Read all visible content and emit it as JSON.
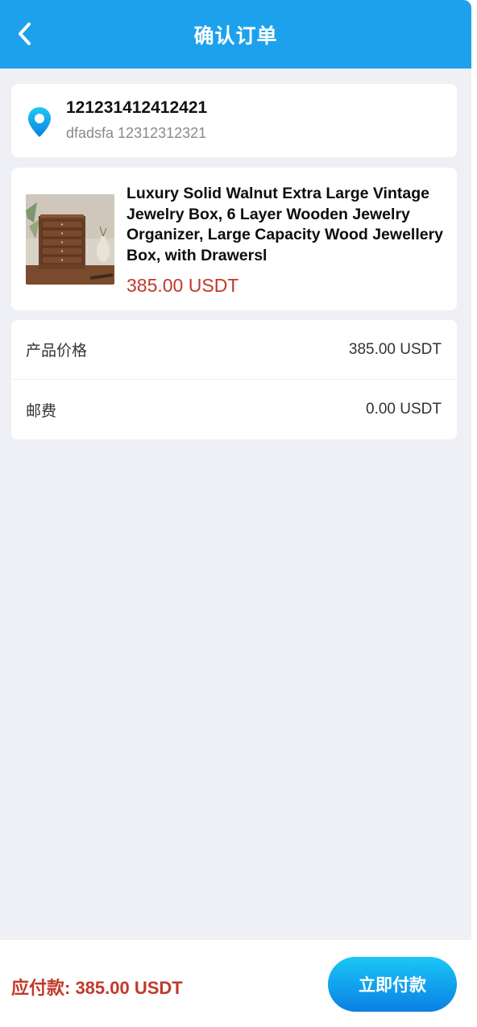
{
  "header": {
    "title": "确认订单",
    "back_icon": "chevron-left-icon",
    "color": "#1da1ec"
  },
  "address": {
    "icon": "location-pin-icon",
    "name": "121231412412421",
    "detail": "dfadsfa 12312312321"
  },
  "product": {
    "image_desc": "wooden-jewelry-box",
    "title": "Luxury Solid Walnut Extra Large Vintage Jewelry Box, 6 Layer Wooden Jewelry Organizer, Large Capacity Wood Jewellery Box, with Drawersl",
    "price": "385.00 USDT"
  },
  "summary": {
    "rows": [
      {
        "label": "产品价格",
        "value": "385.00 USDT"
      },
      {
        "label": "邮费",
        "value": "0.00 USDT"
      }
    ]
  },
  "footer": {
    "total": "应付款: 385.00 USDT",
    "pay_label": "立即付款"
  },
  "colors": {
    "accent": "#1da1ec",
    "price": "#c0392b",
    "background": "#eef0f5"
  }
}
